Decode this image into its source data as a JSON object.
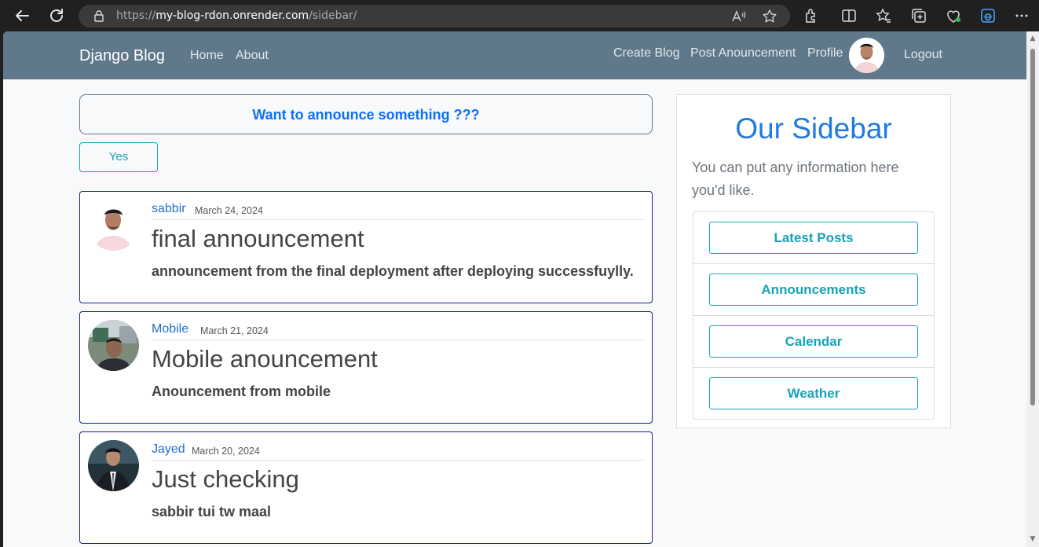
{
  "browser": {
    "url_prefix": "https://",
    "url_host": "my-blog-rdon.onrender.com",
    "url_path": "/sidebar/"
  },
  "navbar": {
    "brand": "Django Blog",
    "left_links": [
      "Home",
      "About"
    ],
    "right_links": [
      "Create Blog",
      "Post Anouncement",
      "Profile"
    ],
    "logout": "Logout"
  },
  "announce": {
    "prompt": "Want to announce something ???",
    "yes_label": "Yes"
  },
  "posts": [
    {
      "author": "sabbir",
      "date": "March 24, 2024",
      "title": "final announcement",
      "body": "announcement from the final deployment after deploying successfuylly."
    },
    {
      "author": "Mobile",
      "date": "March 21, 2024",
      "title": "Mobile anouncement",
      "body": "Anouncement from mobile"
    },
    {
      "author": "Jayed",
      "date": "March 20, 2024",
      "title": "Just checking",
      "body": "sabbir tui tw maal"
    }
  ],
  "sidebar": {
    "heading": "Our Sidebar",
    "text": "You can put any information here you'd like.",
    "items": [
      "Latest Posts",
      "Announcements",
      "Calendar",
      "Weather"
    ]
  },
  "colors": {
    "navbar_bg": "#5f788a",
    "accent_blue": "#1f7ae0",
    "info_teal": "#17a2b8",
    "card_border": "#1a1aa6"
  }
}
